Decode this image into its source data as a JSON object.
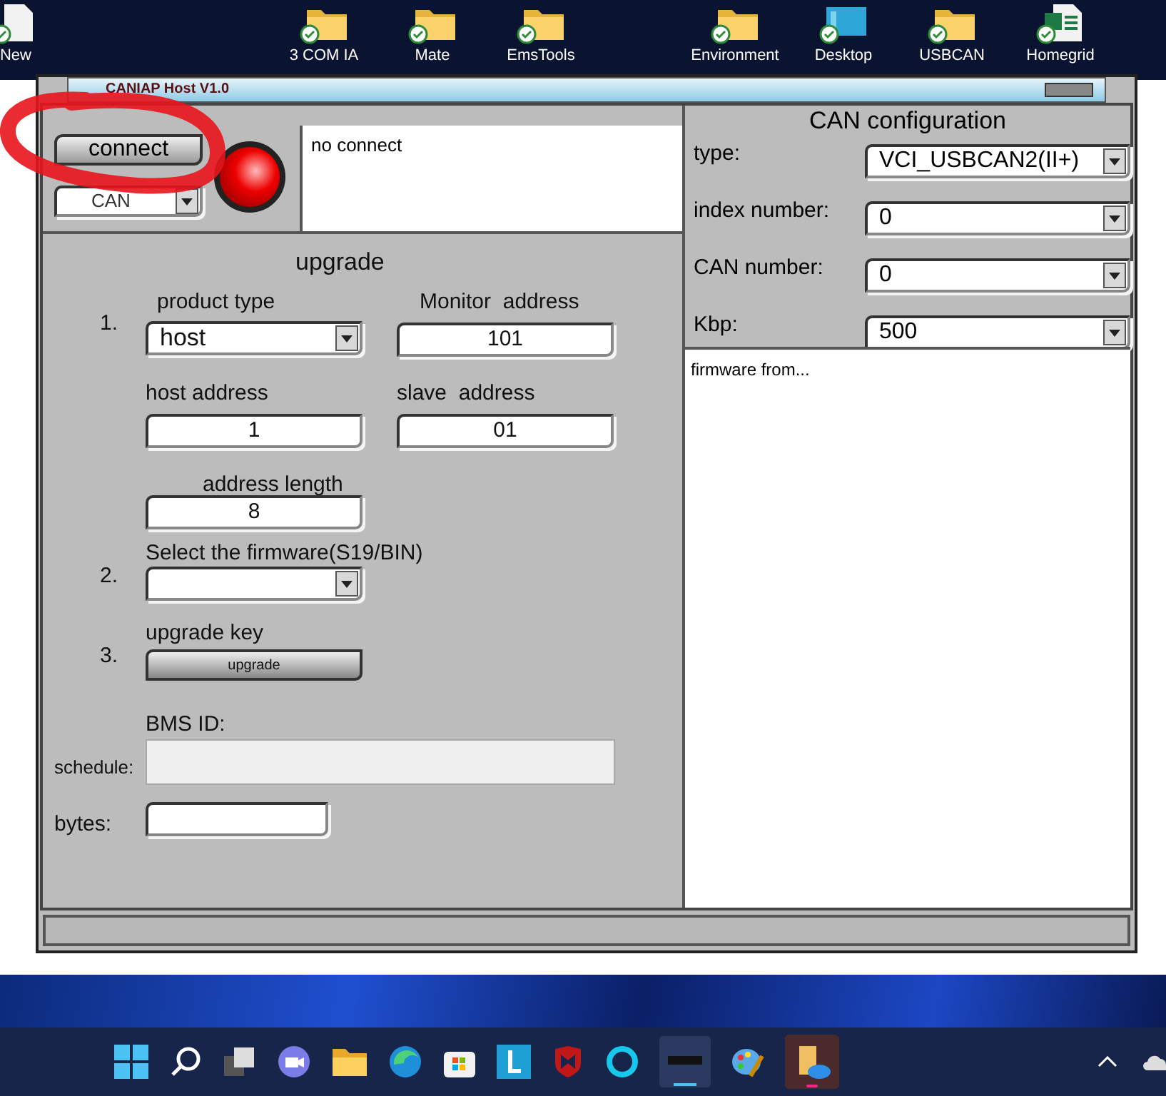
{
  "desktop_icons": [
    {
      "label": "New",
      "kind": "file"
    },
    {
      "label": "3 COM IA",
      "kind": "folder"
    },
    {
      "label": "Mate",
      "kind": "folder"
    },
    {
      "label": "EmsTools",
      "kind": "folder"
    },
    {
      "label": "Environment",
      "kind": "folder"
    },
    {
      "label": "Desktop",
      "kind": "screen"
    },
    {
      "label": "USBCAN",
      "kind": "folder"
    },
    {
      "label": "Homegrid",
      "kind": "sheet"
    }
  ],
  "window": {
    "title": "CANIAP Host V1.0"
  },
  "connection": {
    "connect_button": "connect",
    "interface": "CAN",
    "connected": false,
    "status_text": "no connect"
  },
  "upgrade": {
    "title": "upgrade",
    "step_1": "1.",
    "product_type_label": "product type",
    "product_type": "host",
    "monitor_address_label": "Monitor  address",
    "monitor_address": "101",
    "host_address_label": "host address",
    "host_address": "1",
    "slave_address_label": "slave  address",
    "slave_address": "01",
    "address_length_label": "address length",
    "address_length": "8",
    "step_2": "2.",
    "firmware_label": "Select the firmware(S19/BIN)",
    "step_3": "3.",
    "upgrade_key_label": "upgrade key",
    "upgrade_button": "upgrade",
    "bms_id_label": "BMS ID:",
    "schedule": {
      "label": "schedule:"
    },
    "bytes_label": "bytes:"
  },
  "can_configuration": {
    "title": "CAN configuration",
    "fields": [
      {
        "label": "type:",
        "value": "VCI_USBCAN2(II+)"
      },
      {
        "label": "index number:",
        "value": "0"
      },
      {
        "label": "CAN number:",
        "value": "0"
      },
      {
        "label": "Kbp:",
        "value": "500"
      }
    ],
    "log": "firmware from..."
  }
}
